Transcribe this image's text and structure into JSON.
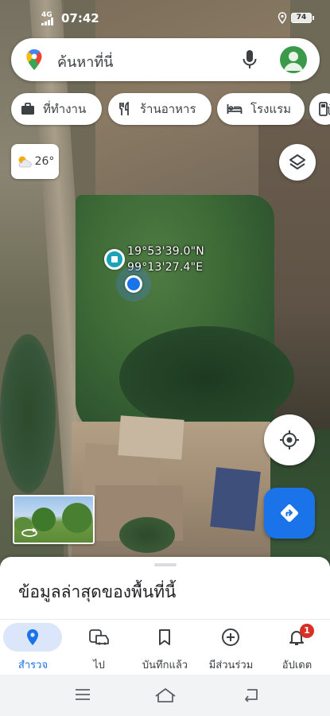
{
  "status_bar": {
    "network": "4G",
    "time": "07:42",
    "battery": "74"
  },
  "search": {
    "placeholder": "ค้นหาที่นี่"
  },
  "chips": [
    {
      "label": "ที่ทำงาน",
      "icon": "briefcase-icon"
    },
    {
      "label": "ร้านอาหาร",
      "icon": "restaurant-icon"
    },
    {
      "label": "โรงแรม",
      "icon": "hotel-icon"
    },
    {
      "label": "",
      "icon": "fuel-icon"
    }
  ],
  "weather": {
    "temperature": "26°",
    "icon": "partly-cloudy-icon"
  },
  "map": {
    "dropped_pin": {
      "latitude": "19°53'39.0\"N",
      "longitude": "99°13'27.4\"E"
    }
  },
  "sheet": {
    "title": "ข้อมูลล่าสุดของพื้นที่นี้"
  },
  "bottom_nav": {
    "items": [
      {
        "label": "สำรวจ",
        "icon": "explore-pin-icon",
        "active": true
      },
      {
        "label": "ไป",
        "icon": "commute-car-icon",
        "active": false
      },
      {
        "label": "บันทึกแล้ว",
        "icon": "bookmark-icon",
        "active": false
      },
      {
        "label": "มีส่วนร่วม",
        "icon": "add-circle-icon",
        "active": false
      },
      {
        "label": "อัปเดต",
        "icon": "bell-icon",
        "active": false,
        "badge": "1"
      }
    ]
  },
  "colors": {
    "accent": "#1a73e8",
    "active_pill": "#dbe6fb",
    "badge": "#d93025",
    "dropped_pin": "#1aa3b8"
  }
}
